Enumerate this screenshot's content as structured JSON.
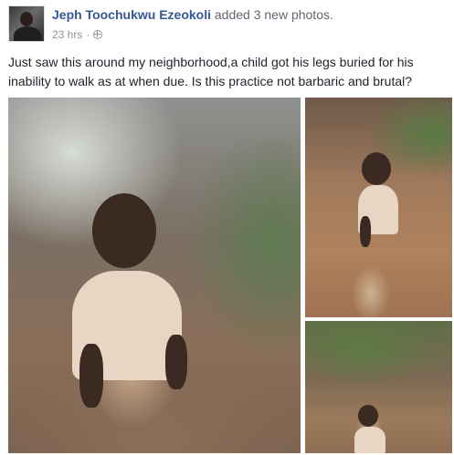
{
  "post": {
    "author": "Jeph Toochukwu Ezeokoli",
    "action": "added 3 new photos.",
    "time": "23 hrs",
    "separator": "·",
    "privacy_icon": "globe-icon",
    "text": "Just saw this around my neighborhood,a child got his legs buried for his inability to walk as at when due. Is this practice not barbaric and brutal?"
  },
  "colors": {
    "author": "#365899",
    "meta": "#90949c",
    "text": "#1d2129"
  }
}
